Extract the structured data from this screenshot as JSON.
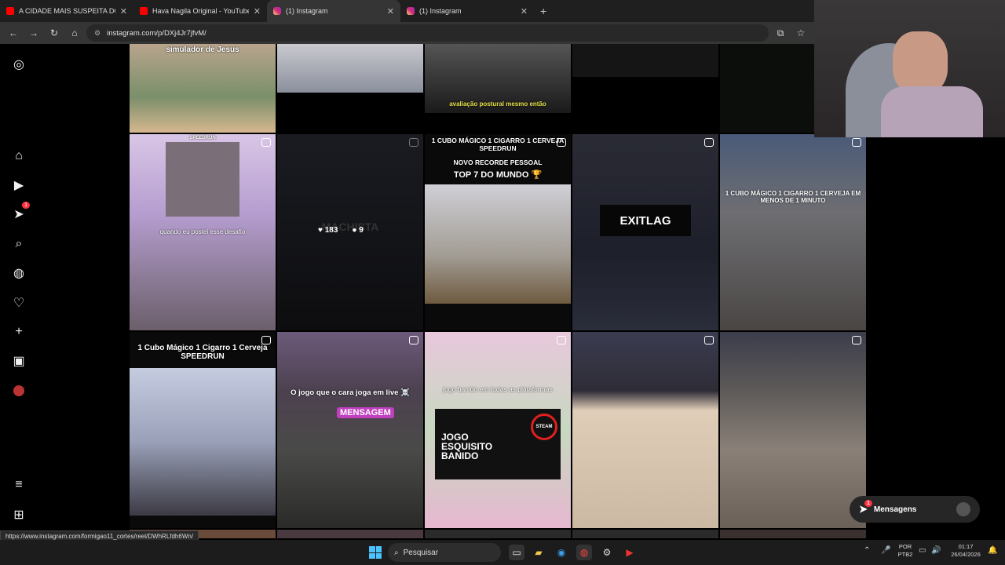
{
  "tabs": [
    {
      "title": "A CIDADE MAIS SUSPEITA DO ...",
      "icon": "youtube-icon"
    },
    {
      "title": "Hava Nagila Original - YouTube",
      "icon": "youtube-icon"
    },
    {
      "title": "(1) Instagram",
      "icon": "instagram-icon"
    },
    {
      "title": "(1) Instagram",
      "icon": "instagram-icon"
    }
  ],
  "address": {
    "url": "instagram.com/p/DXj4Jr7jfvM/"
  },
  "sidebar": {
    "notification_badge": "1"
  },
  "posts": {
    "c1": "simulador de Jesus",
    "c3": "avaliação postural mesmo então",
    "c5a": "SPEEDRUN",
    "c5b": "quando eu postei esse desafio",
    "c6_likes": "183",
    "c6_comments": "9",
    "c6_overlay": "MACHISTA",
    "c7a": "1 CUBO MÁGICO 1 CIGARRO 1 CERVEJA SPEEDRUN",
    "c7b": "NOVO RECORDE PESSOAL",
    "c7c": "TOP 7 DO MUNDO 🏆",
    "c8": "EXITLAG",
    "c9": "1 CUBO MÁGICO 1 CIGARRO 1 CERVEJA EM MENOS DE 1 MINUTO",
    "c10": "1 Cubo Mágico 1 Cigarro 1 Cerveja SPEEDRUN",
    "c11a": "O jogo que o cara joga em live ☠️",
    "c11b": "MENSAGEM",
    "c12a": "jogo banido em todas as plataformas",
    "c12b": "JOGO ESQUISITO BANIDO",
    "c12c": "STEAM"
  },
  "messages": {
    "label": "Mensagens",
    "badge": "1"
  },
  "status_url": "https://www.instagram.com/formigao11_cortes/reel/DWhRLfdh6Wn/",
  "taskbar": {
    "search": "Pesquisar",
    "lang": "POR",
    "layout": "PTB2",
    "time": "01:17",
    "date": "26/04/2026"
  }
}
